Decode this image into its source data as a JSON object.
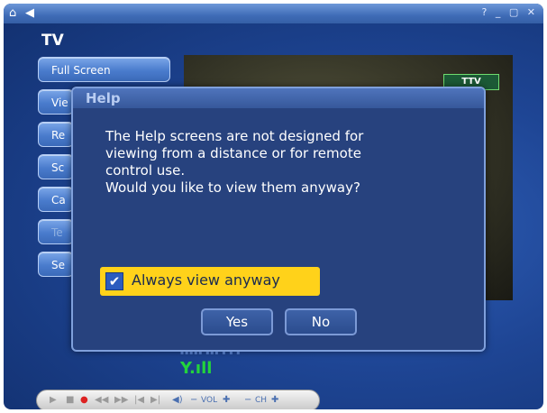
{
  "window": {
    "controls": "? _ ▢ ✕"
  },
  "page": {
    "title": "TV"
  },
  "menu": {
    "items": [
      {
        "label": "Full Screen"
      },
      {
        "label": "Vie"
      },
      {
        "label": "Re"
      },
      {
        "label": "Sc"
      },
      {
        "label": "Ca"
      },
      {
        "label": "Te"
      },
      {
        "label": "Se"
      }
    ]
  },
  "preview": {
    "channel_logo": "TTV"
  },
  "dialog": {
    "title": "Help",
    "message_lines": [
      "The Help screens are not designed for",
      "viewing from a distance or for remote",
      "control use.",
      "Would you like to view them anyway?"
    ],
    "checkbox_label": "Always view anyway",
    "checkbox_checked": true,
    "yes_label": "Yes",
    "no_label": "No"
  },
  "transport": {
    "vol_label": "VOL",
    "ch_label": "CH"
  },
  "colors": {
    "background": "#1e4594",
    "checkbox_highlight": "#ffd21a",
    "signal": "#23d43c"
  }
}
